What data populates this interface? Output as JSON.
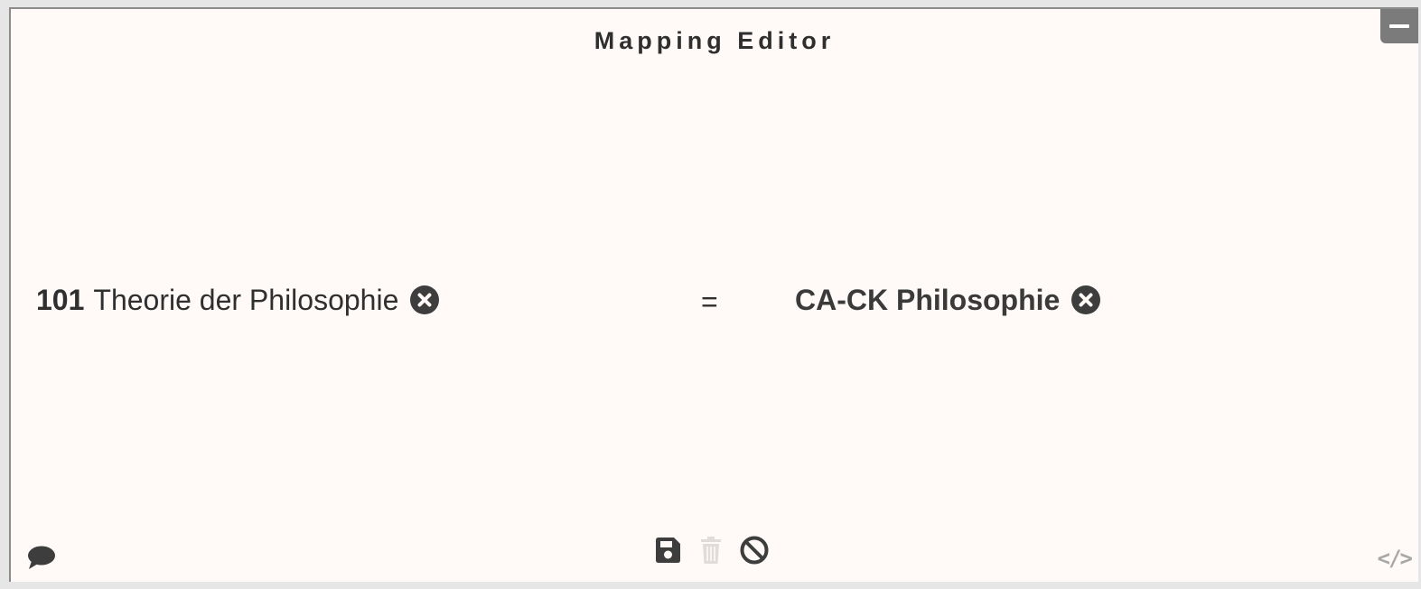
{
  "editor": {
    "title": "Mapping Editor"
  },
  "source_concept": {
    "notation": "101",
    "label": "Theorie der Philosophie"
  },
  "relation": {
    "symbol": "="
  },
  "target_concept": {
    "label": "CA-CK Philosophie"
  },
  "footer": {
    "code_symbol": "</>"
  },
  "icons": {
    "minimize": "minus-icon",
    "remove": "times-circle-icon",
    "comment": "comment-icon",
    "save": "save-icon",
    "delete": "trash-icon",
    "cancel": "ban-icon",
    "code": "code-icon"
  },
  "colors": {
    "panel_background": "#fffaf8",
    "text": "#2f2f2f",
    "icon": "#3d3d3d",
    "disabled_icon": "#e0dcdb",
    "minimize_button": "#7b7b7b"
  }
}
